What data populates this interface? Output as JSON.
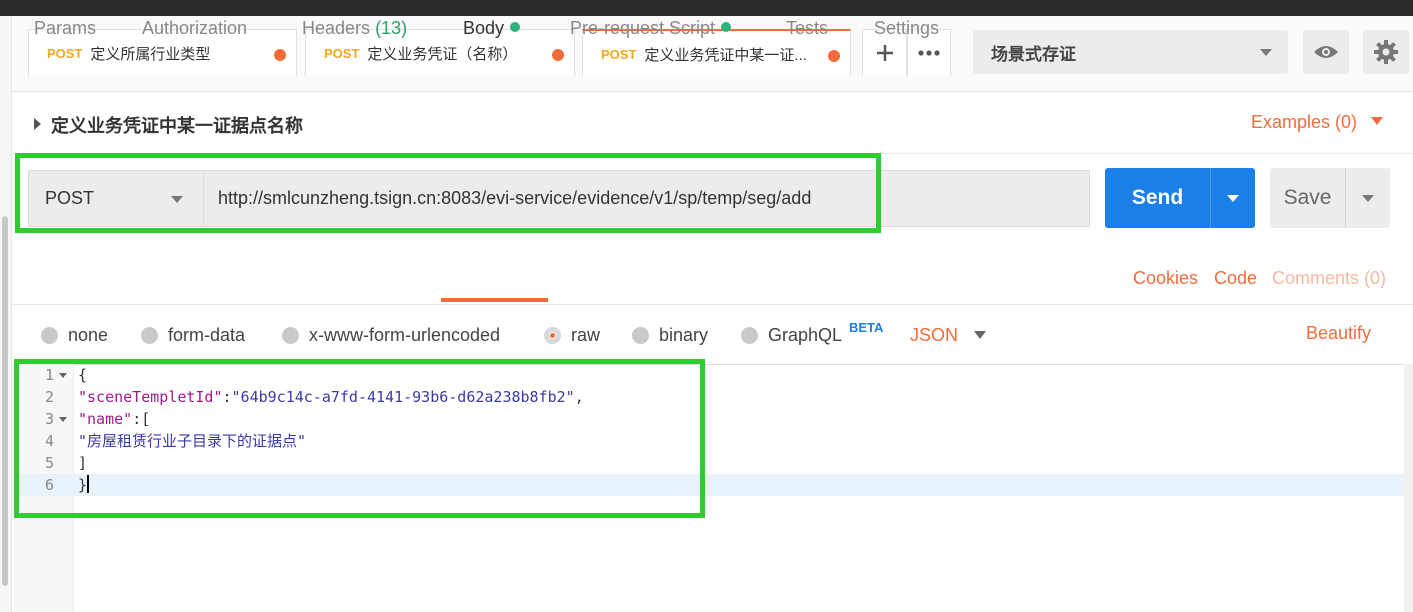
{
  "open_tabs": [
    {
      "method": "POST",
      "name": "定义所属行业类型",
      "active": false
    },
    {
      "method": "POST",
      "name": "定义业务凭证（名称）",
      "active": false
    },
    {
      "method": "POST",
      "name": "定义业务凭证中某一证...",
      "active": true
    }
  ],
  "environment": {
    "selected": "场景式存证"
  },
  "request": {
    "name": "定义业务凭证中某一证据点名称",
    "examples_label": "Examples (0)",
    "method": "POST",
    "url": "http://smlcunzheng.tsign.cn:8083/evi-service/evidence/v1/sp/temp/seg/add",
    "send_label": "Send",
    "save_label": "Save"
  },
  "request_tabs": {
    "params": "Params",
    "authorization": "Authorization",
    "headers": "Headers",
    "headers_count": "(13)",
    "body": "Body",
    "pre_request": "Pre-request Script",
    "tests": "Tests",
    "settings": "Settings",
    "active": "Body"
  },
  "request_links": {
    "cookies": "Cookies",
    "code": "Code",
    "comments": "Comments (0)"
  },
  "body_modes": {
    "options": [
      "none",
      "form-data",
      "x-www-form-urlencoded",
      "raw",
      "binary",
      "GraphQL"
    ],
    "selected": "raw",
    "beta_badge": "BETA",
    "format": "JSON",
    "beautify": "Beautify"
  },
  "editor": {
    "line_numbers": [
      "1",
      "2",
      "3",
      "4",
      "5",
      "6"
    ],
    "lines": [
      {
        "punct_open": "{"
      },
      {
        "key": "\"sceneTempletId\"",
        "sep": ":",
        "value": "\"64b9c14c-a7fd-4141-93b6-d62a238b8fb2\"",
        "trail": ","
      },
      {
        "key": "\"name\"",
        "sep": ":["
      },
      {
        "value": "\"房屋租赁行业子目录下的证据点\""
      },
      {
        "punct": "]"
      },
      {
        "punct": "}"
      }
    ],
    "highlighted_line": 6
  },
  "colors": {
    "accent": "#f26b3a",
    "send": "#1a7fe6",
    "annotation": "#2ecc2e",
    "method": "#f5a623"
  }
}
